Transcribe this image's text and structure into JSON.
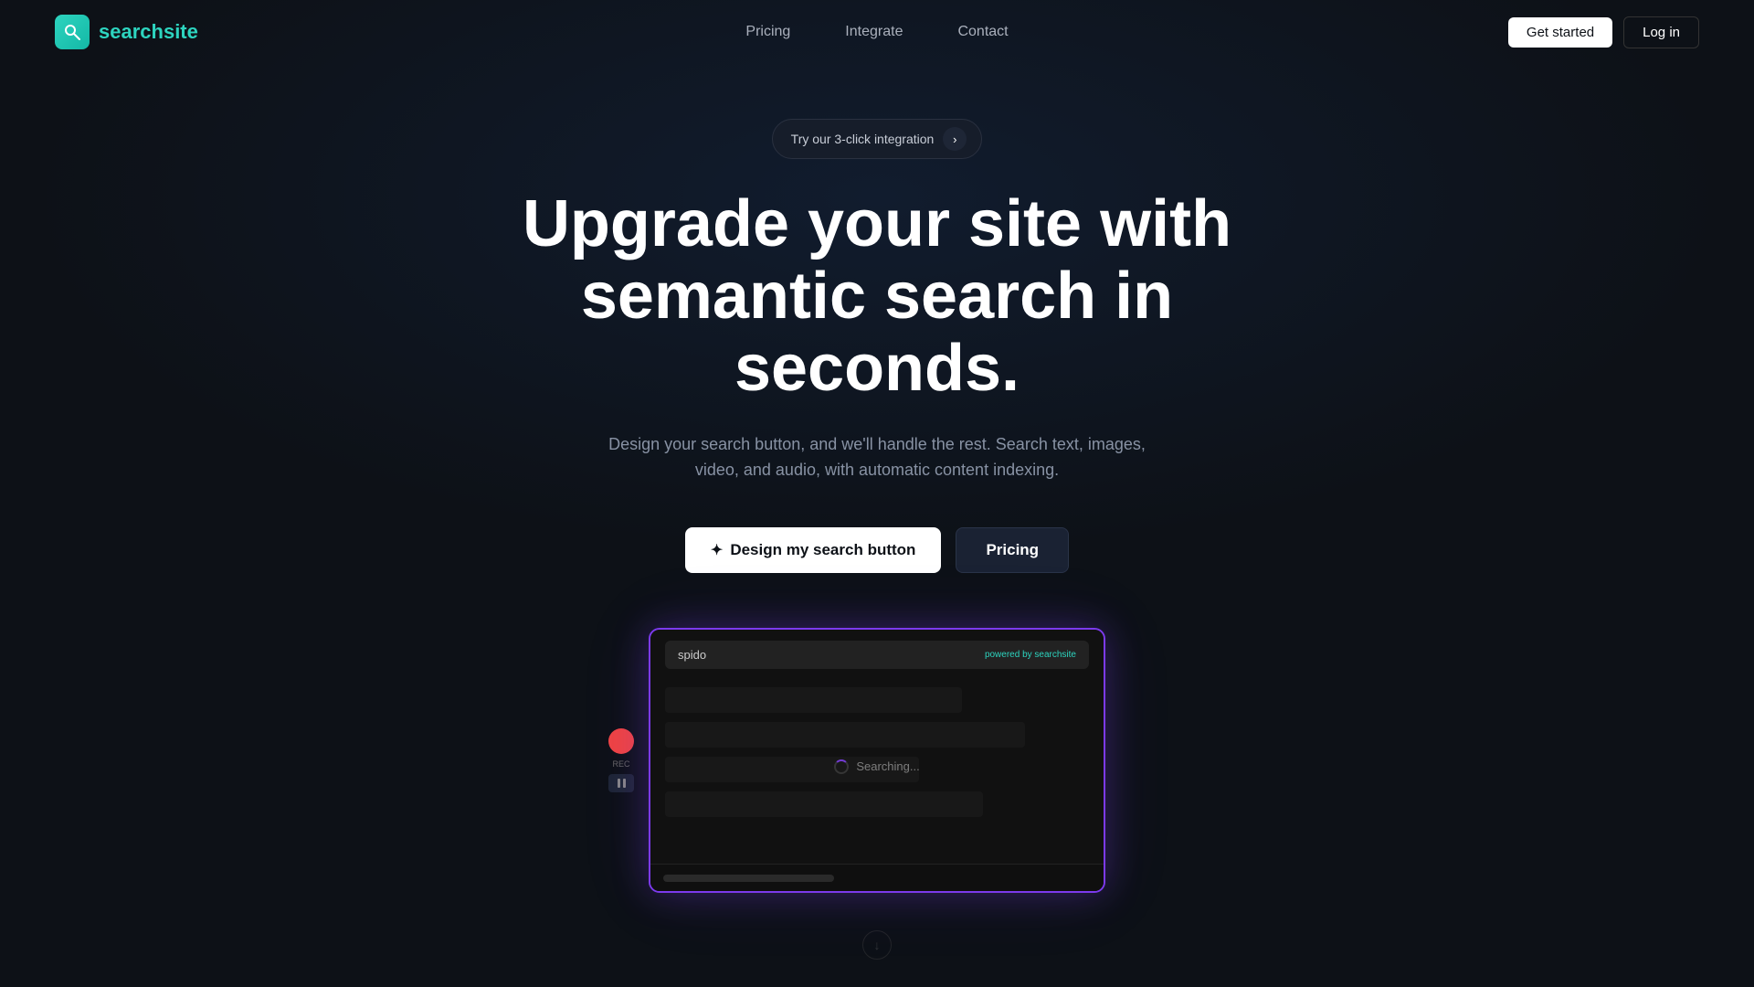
{
  "brand": {
    "logo_icon": "🔍",
    "logo_prefix": "search",
    "logo_suffix": "site"
  },
  "nav": {
    "links": [
      {
        "label": "Pricing",
        "id": "nav-pricing"
      },
      {
        "label": "Integrate",
        "id": "nav-integrate"
      },
      {
        "label": "Contact",
        "id": "nav-contact"
      }
    ],
    "get_started_label": "Get started",
    "login_label": "Log in"
  },
  "hero": {
    "badge_text": "Try our 3-click integration",
    "headline_line1": "Upgrade your site with",
    "headline_line2": "semantic search in seconds.",
    "subheadline": "Design your search button, and we'll handle the rest. Search text, images, video, and audio, with automatic content indexing.",
    "btn_design_label": "Design my search button",
    "btn_pricing_label": "Pricing"
  },
  "demo": {
    "search_query": "spido",
    "powered_label": "powered by",
    "powered_brand": "searchsite",
    "searching_label": "Searching..."
  },
  "scroll": {
    "icon": "↓"
  },
  "colors": {
    "bg": "#0d1117",
    "accent_teal": "#2dd4bf",
    "accent_purple": "#7c3aed",
    "text_muted": "#8892a4"
  }
}
